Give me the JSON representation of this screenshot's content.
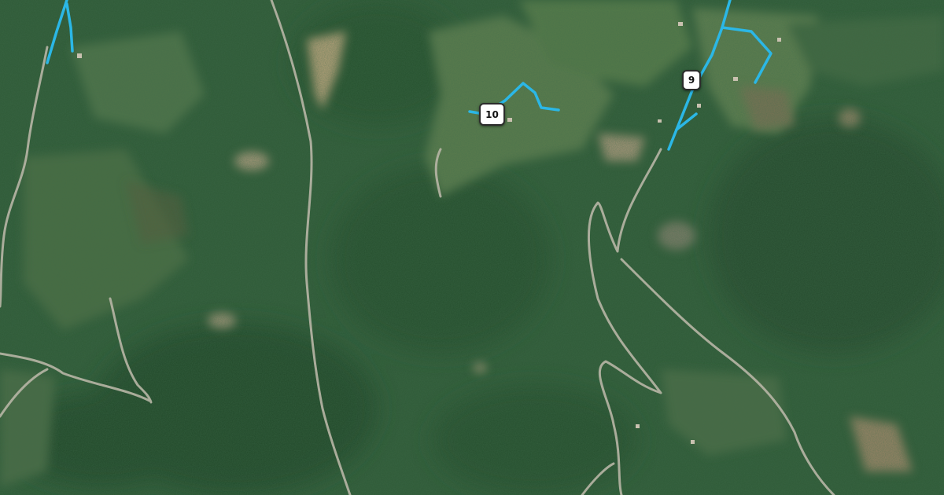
{
  "map": {
    "type": "satellite",
    "route_color": "#2bb7e6",
    "markers": [
      {
        "label": "9"
      },
      {
        "label": "10"
      }
    ]
  }
}
